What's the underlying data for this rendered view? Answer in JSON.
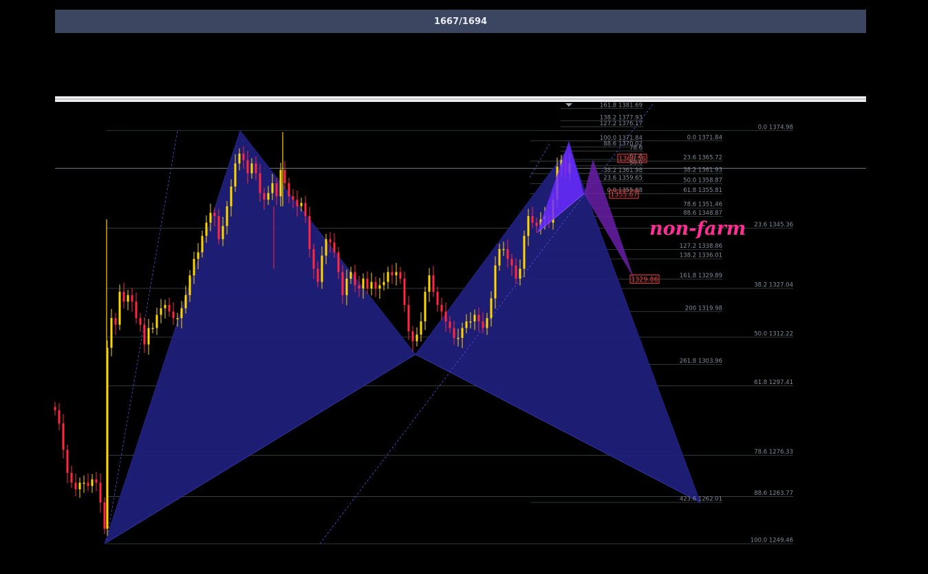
{
  "header": {
    "counter": "1667/1694"
  },
  "annotation": {
    "text": "non-farm"
  },
  "colors": {
    "pattern_fill": "#1f1f7a",
    "pattern_small": "#6a2bff",
    "projection": "#6a1fa8",
    "candle_up": "#ffd700",
    "candle_down": "#ff2840",
    "annotation": "#ff2d95",
    "trendline": "#4a4ad8"
  },
  "chart_data": {
    "type": "candlestick",
    "price_range": [
      1245,
      1385
    ],
    "fib_levels_major": [
      {
        "label": "0.0 1374.98",
        "price": 1374.98
      },
      {
        "label": "23.6 1345.36",
        "price": 1345.36
      },
      {
        "label": "38.2 1327.04",
        "price": 1327.04
      },
      {
        "label": "50.0 1312.22",
        "price": 1312.22
      },
      {
        "label": "61.8 1297.41",
        "price": 1297.41
      },
      {
        "label": "78.6 1276.33",
        "price": 1276.33
      },
      {
        "label": "88.6 1263.77",
        "price": 1263.77
      },
      {
        "label": "100.0 1249.46",
        "price": 1249.46
      }
    ],
    "fib_levels_mid": [
      {
        "label": "0.0 1371.84",
        "price": 1371.84
      },
      {
        "label": "23.6 1365.72",
        "price": 1365.72
      },
      {
        "label": "38.2 1361.93",
        "price": 1361.93
      },
      {
        "label": "50.0 1358.87",
        "price": 1358.87
      },
      {
        "label": "61.8 1355.81",
        "price": 1355.81
      },
      {
        "label": "78.6 1351.46",
        "price": 1351.46
      },
      {
        "label": "88.6 1348.87",
        "price": 1348.87
      },
      {
        "label": "127.2 1338.86",
        "price": 1338.86
      },
      {
        "label": "138.2 1336.01",
        "price": 1336.01
      },
      {
        "label": "161.8 1329.89",
        "price": 1329.89
      },
      {
        "label": "200 1319.98",
        "price": 1319.98
      },
      {
        "label": "261.8 1303.96",
        "price": 1303.96
      },
      {
        "label": "423.6 1262.01",
        "price": 1262.01
      }
    ],
    "fib_levels_small": [
      {
        "label": "161.8 1381.69",
        "price": 1381.69
      },
      {
        "label": "138.2 1377.93",
        "price": 1377.93
      },
      {
        "label": "127.2 1376.17",
        "price": 1376.17
      },
      {
        "label": "100.0 1371.84",
        "price": 1371.84
      },
      {
        "label": "88.6 1370.02",
        "price": 1370.02
      },
      {
        "label": "78.6",
        "price": 1368.8
      },
      {
        "label": "61.8",
        "price": 1366.3
      },
      {
        "label": "50.0",
        "price": 1364.3
      },
      {
        "label": "38.2 1361.98",
        "price": 1361.98
      },
      {
        "label": "23.6 1359.65",
        "price": 1359.65
      },
      {
        "label": "0.0 1355.88",
        "price": 1355.88
      }
    ],
    "price_tags": [
      {
        "label": "1366.56",
        "price": 1366.56
      },
      {
        "label": "1355.67",
        "price": 1355.67
      },
      {
        "label": "1329.86",
        "price": 1329.86
      }
    ],
    "horizontal_line_price": 1363.5,
    "pattern_big_points": [
      {
        "t": 152,
        "price": 1249.46
      },
      {
        "t": 349,
        "price": 1374.98
      },
      {
        "t": 604,
        "price": 1307.0
      },
      {
        "t": 827,
        "price": 1370.0
      },
      {
        "t": 1018,
        "price": 1262.01
      }
    ],
    "pattern_small_points": [
      {
        "t": 781,
        "price": 1344.0
      },
      {
        "t": 827,
        "price": 1371.84
      },
      {
        "t": 849,
        "price": 1355.8
      },
      {
        "t": 862,
        "price": 1366.3
      },
      {
        "t": 922,
        "price": 1329.89
      }
    ],
    "candles_close": [
      {
        "t": 80,
        "price": 1290
      },
      {
        "t": 86,
        "price": 1286
      },
      {
        "t": 92,
        "price": 1278
      },
      {
        "t": 98,
        "price": 1271
      },
      {
        "t": 104,
        "price": 1268
      },
      {
        "t": 110,
        "price": 1266
      },
      {
        "t": 116,
        "price": 1268
      },
      {
        "t": 122,
        "price": 1268
      },
      {
        "t": 128,
        "price": 1267
      },
      {
        "t": 134,
        "price": 1269
      },
      {
        "t": 140,
        "price": 1268
      },
      {
        "t": 146,
        "price": 1262
      },
      {
        "t": 152,
        "price": 1254
      },
      {
        "t": 156,
        "price": 1309
      },
      {
        "t": 162,
        "price": 1318
      },
      {
        "t": 168,
        "price": 1316
      },
      {
        "t": 174,
        "price": 1326
      },
      {
        "t": 180,
        "price": 1323
      },
      {
        "t": 186,
        "price": 1325
      },
      {
        "t": 192,
        "price": 1323
      },
      {
        "t": 198,
        "price": 1318
      },
      {
        "t": 204,
        "price": 1316
      },
      {
        "t": 210,
        "price": 1310
      },
      {
        "t": 216,
        "price": 1315
      },
      {
        "t": 222,
        "price": 1315
      },
      {
        "t": 228,
        "price": 1319
      },
      {
        "t": 234,
        "price": 1321
      },
      {
        "t": 240,
        "price": 1322
      },
      {
        "t": 246,
        "price": 1320
      },
      {
        "t": 252,
        "price": 1318
      },
      {
        "t": 258,
        "price": 1318
      },
      {
        "t": 264,
        "price": 1321
      },
      {
        "t": 270,
        "price": 1325
      },
      {
        "t": 276,
        "price": 1331
      },
      {
        "t": 282,
        "price": 1336
      },
      {
        "t": 288,
        "price": 1338
      },
      {
        "t": 294,
        "price": 1343
      },
      {
        "t": 300,
        "price": 1347
      },
      {
        "t": 306,
        "price": 1350
      },
      {
        "t": 312,
        "price": 1349
      },
      {
        "t": 318,
        "price": 1342
      },
      {
        "t": 324,
        "price": 1346
      },
      {
        "t": 330,
        "price": 1352
      },
      {
        "t": 336,
        "price": 1358
      },
      {
        "t": 342,
        "price": 1365
      },
      {
        "t": 348,
        "price": 1368
      },
      {
        "t": 354,
        "price": 1366
      },
      {
        "t": 360,
        "price": 1362
      },
      {
        "t": 366,
        "price": 1365
      },
      {
        "t": 372,
        "price": 1362
      },
      {
        "t": 378,
        "price": 1356
      },
      {
        "t": 384,
        "price": 1354
      },
      {
        "t": 390,
        "price": 1356
      },
      {
        "t": 396,
        "price": 1359
      },
      {
        "t": 402,
        "price": 1355
      },
      {
        "t": 408,
        "price": 1363
      },
      {
        "t": 414,
        "price": 1359
      },
      {
        "t": 420,
        "price": 1355
      },
      {
        "t": 426,
        "price": 1354
      },
      {
        "t": 432,
        "price": 1352
      },
      {
        "t": 438,
        "price": 1353
      },
      {
        "t": 444,
        "price": 1349
      },
      {
        "t": 450,
        "price": 1339
      },
      {
        "t": 456,
        "price": 1333
      },
      {
        "t": 462,
        "price": 1329
      },
      {
        "t": 468,
        "price": 1337
      },
      {
        "t": 474,
        "price": 1342
      },
      {
        "t": 480,
        "price": 1341
      },
      {
        "t": 486,
        "price": 1338
      },
      {
        "t": 492,
        "price": 1332
      },
      {
        "t": 498,
        "price": 1325
      },
      {
        "t": 504,
        "price": 1330
      },
      {
        "t": 510,
        "price": 1332
      },
      {
        "t": 516,
        "price": 1328
      },
      {
        "t": 522,
        "price": 1327
      },
      {
        "t": 528,
        "price": 1330
      },
      {
        "t": 534,
        "price": 1327
      },
      {
        "t": 540,
        "price": 1329
      },
      {
        "t": 546,
        "price": 1327
      },
      {
        "t": 552,
        "price": 1328
      },
      {
        "t": 558,
        "price": 1329
      },
      {
        "t": 564,
        "price": 1332
      },
      {
        "t": 570,
        "price": 1331
      },
      {
        "t": 576,
        "price": 1332
      },
      {
        "t": 582,
        "price": 1330
      },
      {
        "t": 588,
        "price": 1322
      },
      {
        "t": 594,
        "price": 1314
      },
      {
        "t": 600,
        "price": 1311
      },
      {
        "t": 606,
        "price": 1313
      },
      {
        "t": 612,
        "price": 1317
      },
      {
        "t": 618,
        "price": 1326
      },
      {
        "t": 624,
        "price": 1331
      },
      {
        "t": 630,
        "price": 1326
      },
      {
        "t": 636,
        "price": 1322
      },
      {
        "t": 642,
        "price": 1320
      },
      {
        "t": 648,
        "price": 1317
      },
      {
        "t": 654,
        "price": 1315
      },
      {
        "t": 660,
        "price": 1312
      },
      {
        "t": 666,
        "price": 1312
      },
      {
        "t": 672,
        "price": 1315
      },
      {
        "t": 678,
        "price": 1317
      },
      {
        "t": 684,
        "price": 1317
      },
      {
        "t": 690,
        "price": 1319
      },
      {
        "t": 696,
        "price": 1317
      },
      {
        "t": 702,
        "price": 1315
      },
      {
        "t": 708,
        "price": 1318
      },
      {
        "t": 714,
        "price": 1324
      },
      {
        "t": 720,
        "price": 1334
      },
      {
        "t": 726,
        "price": 1339
      },
      {
        "t": 732,
        "price": 1339
      },
      {
        "t": 738,
        "price": 1336
      },
      {
        "t": 744,
        "price": 1334
      },
      {
        "t": 750,
        "price": 1330
      },
      {
        "t": 756,
        "price": 1333
      },
      {
        "t": 762,
        "price": 1343
      },
      {
        "t": 768,
        "price": 1349
      },
      {
        "t": 774,
        "price": 1347
      },
      {
        "t": 780,
        "price": 1346
      },
      {
        "t": 786,
        "price": 1348
      },
      {
        "t": 792,
        "price": 1349
      },
      {
        "t": 798,
        "price": 1347
      },
      {
        "t": 804,
        "price": 1354
      },
      {
        "t": 810,
        "price": 1364
      },
      {
        "t": 816,
        "price": 1366
      },
      {
        "t": 822,
        "price": 1362
      },
      {
        "t": 828,
        "price": 1365
      }
    ]
  }
}
